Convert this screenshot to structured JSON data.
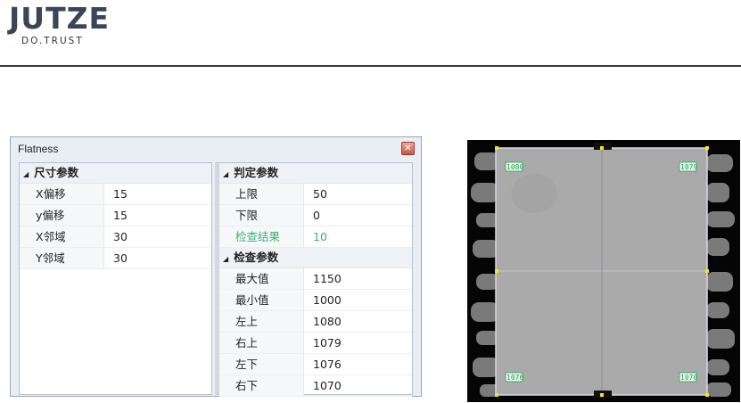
{
  "brand": {
    "logo_text": "JUTZE",
    "tagline": "DO.TRUST"
  },
  "dialog": {
    "title": "Flatness",
    "close_icon": "close-icon",
    "left_group": {
      "label": "尺寸参数",
      "rows": [
        {
          "key": "X偏移",
          "value": "15"
        },
        {
          "key": "y偏移",
          "value": "15"
        },
        {
          "key": "X邻域",
          "value": "30"
        },
        {
          "key": "Y邻域",
          "value": "30"
        }
      ]
    },
    "judge_group": {
      "label": "判定参数",
      "rows": [
        {
          "key": "上限",
          "value": "50"
        },
        {
          "key": "下限",
          "value": "0"
        },
        {
          "key": "检查结果",
          "value": "10",
          "highlight_color": "#3cb371"
        }
      ]
    },
    "check_group": {
      "label": "检查参数",
      "rows": [
        {
          "key": "最大值",
          "value": "1150"
        },
        {
          "key": "最小值",
          "value": "1000"
        },
        {
          "key": "左上",
          "value": "1080"
        },
        {
          "key": "右上",
          "value": "1079"
        },
        {
          "key": "左下",
          "value": "1076"
        },
        {
          "key": "右下",
          "value": "1070"
        }
      ]
    }
  },
  "image_view": {
    "corner_labels": {
      "top_left": "1080",
      "top_right": "1079",
      "bottom_left": "1076",
      "bottom_right": "1070"
    },
    "label_color": "#1aa84a"
  }
}
